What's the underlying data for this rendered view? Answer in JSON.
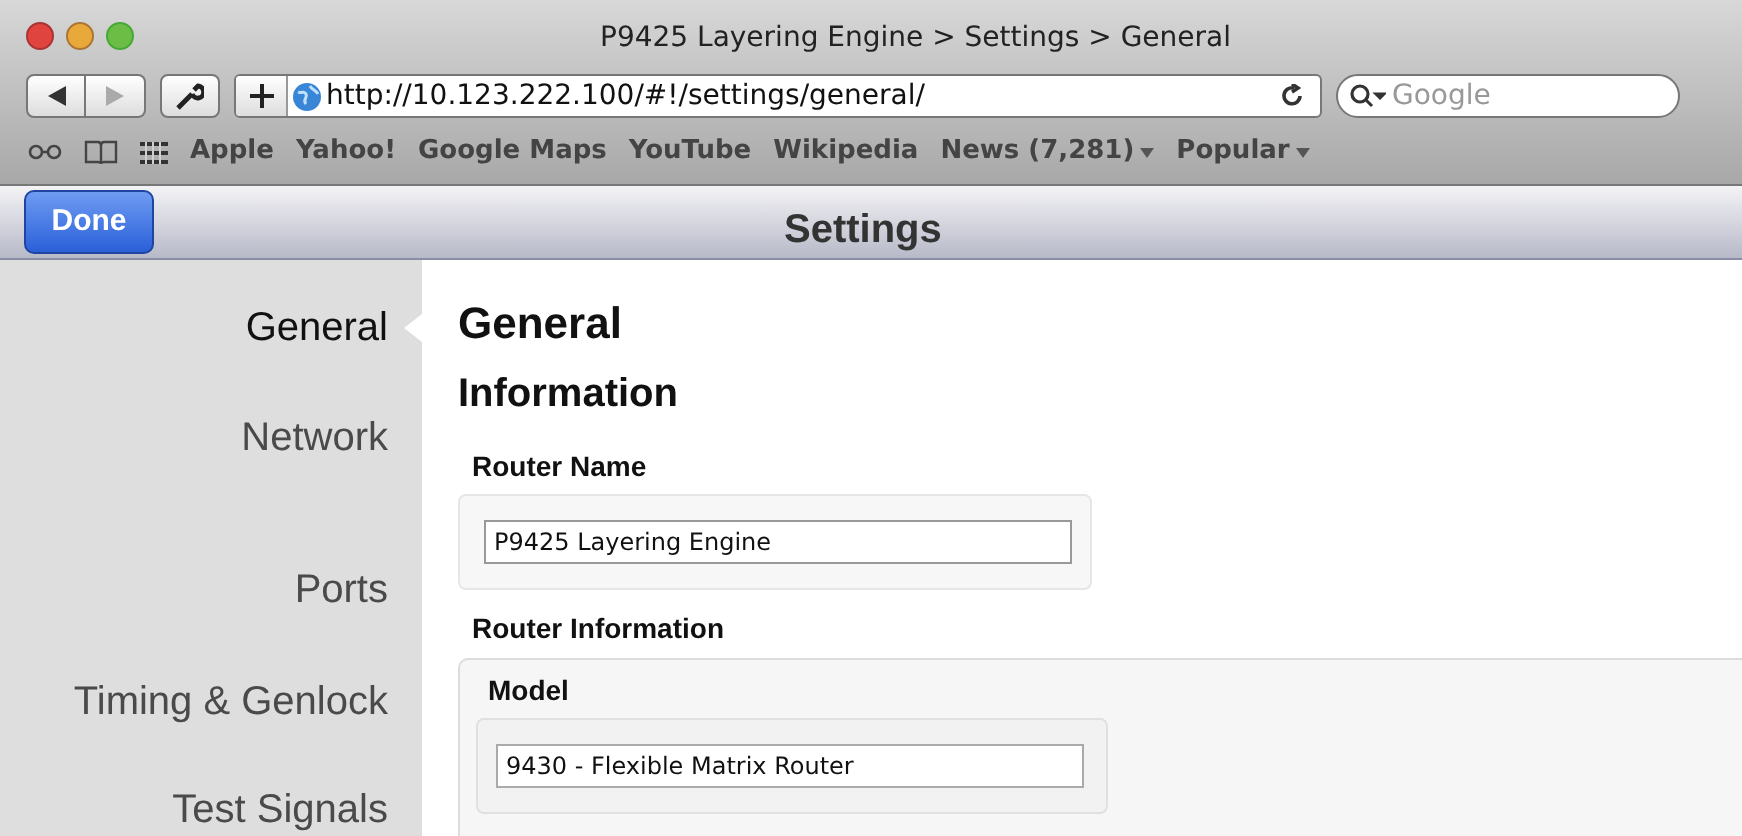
{
  "window": {
    "title": "P9425 Layering Engine > Settings > General"
  },
  "toolbar": {
    "url": "http://10.123.222.100/#!/settings/general/",
    "search": {
      "placeholder": "Google"
    }
  },
  "bookmarks": [
    {
      "label": "Apple",
      "menu": false
    },
    {
      "label": "Yahoo!",
      "menu": false
    },
    {
      "label": "Google Maps",
      "menu": false
    },
    {
      "label": "YouTube",
      "menu": false
    },
    {
      "label": "Wikipedia",
      "menu": false
    },
    {
      "label": "News (7,281)",
      "menu": true
    },
    {
      "label": "Popular",
      "menu": true
    }
  ],
  "header": {
    "done_button": "Done",
    "title": "Settings"
  },
  "sidebar": {
    "items": [
      {
        "label": "General",
        "selected": true
      },
      {
        "label": "Network",
        "selected": false
      },
      {
        "label": "Ports",
        "selected": false
      },
      {
        "label": "Timing & Genlock",
        "selected": false
      },
      {
        "label": "Test Signals",
        "selected": false
      }
    ]
  },
  "content": {
    "title": "General",
    "section": "Information",
    "router_name": {
      "label": "Router Name",
      "value": "P9425 Layering Engine"
    },
    "router_information": {
      "label": "Router Information",
      "model": {
        "label": "Model",
        "value": "9430 - Flexible Matrix Router"
      }
    }
  }
}
